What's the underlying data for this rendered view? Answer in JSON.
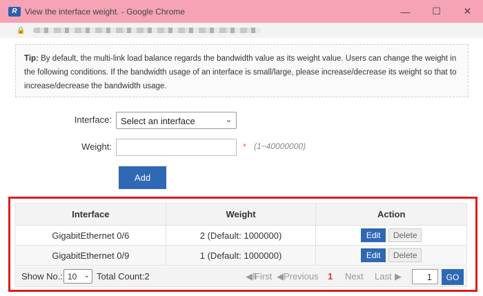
{
  "window": {
    "logo": "R",
    "title": "View the interface weight. - Google Chrome",
    "minimize_glyph": "—",
    "maximize_glyph": "☐",
    "close_glyph": "✕"
  },
  "tip": {
    "label": "Tip:",
    "text": "By default, the multi-link load balance regards the bandwidth value as its weight value. Users can change the weight in the following conditions. If the bandwidth usage of an interface is small/large, please increase/decrease its weight so that to increase/decrease the bandwidth usage."
  },
  "form": {
    "interface_label": "Interface:",
    "interface_selected": "Select an interface",
    "weight_label": "Weight:",
    "weight_value": "",
    "required_mark": "*",
    "weight_range": "(1~40000000)",
    "add_label": "Add"
  },
  "table": {
    "headers": [
      "Interface",
      "Weight",
      "Action"
    ],
    "rows": [
      {
        "interface": "GigabitEthernet 0/6",
        "weight": "2  (Default: 1000000)",
        "edit": "Edit",
        "delete": "Delete"
      },
      {
        "interface": "GigabitEthernet 0/9",
        "weight": "1  (Default: 1000000)",
        "edit": "Edit",
        "delete": "Delete"
      }
    ]
  },
  "pager": {
    "show_label": "Show No.:",
    "page_size": "10",
    "total": "Total Count:2",
    "first": "First",
    "previous": "Previous",
    "current": "1",
    "next": "Next",
    "last": "Last",
    "page_input": "1",
    "go": "GO"
  },
  "colors": {
    "titlebar": "#f5a3b5",
    "accent": "#2f68b4",
    "highlight_frame": "#e01b1b"
  }
}
